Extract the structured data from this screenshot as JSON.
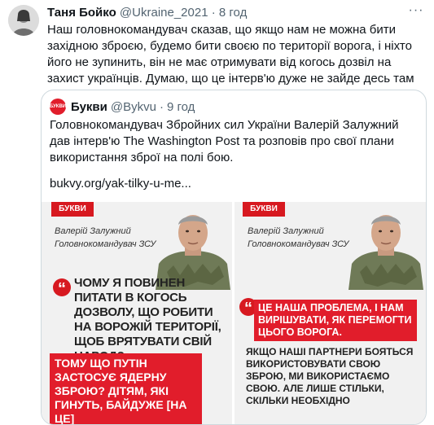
{
  "author": {
    "name": "Таня Бойко",
    "handle": "@Ukraine_2021",
    "separator": "·",
    "time": "8 год"
  },
  "more_label": "···",
  "tweet_text": "Наш головнокомандувач сказав, що якщо нам не можна бити західною зброєю, будемо бити своєю по території ворога, і ніхто його не зупинить, він не має отримувати від когось дозвіл на захист українців. Думаю, що це інтерв'ю дуже не зайде десь там кой кому.",
  "quoted": {
    "logo_text": "БУКВИ",
    "name": "Букви",
    "handle": "@Bykvu",
    "separator": "·",
    "time": "9 год",
    "text": "Головнокомандувач Збройних сил України Валерій Залужний дав інтерв'ю The Washington Post та розповів про свої плани використання зброї на полі бою.",
    "link": "bukvy.org/yak-tilky-u-me..."
  },
  "images": {
    "left": {
      "brand": "БУКВИ",
      "person_name": "Валерій Залужний",
      "person_title": "Головнокомандувач ЗСУ",
      "quote_mark": "“",
      "question": "ЧОМУ Я ПОВИНЕН ПИТАТИ В КОГОСЬ ДОЗВОЛУ, ЩО РОБИТИ НА ВОРОЖІЙ ТЕРИТОРІЇ, ЩОБ ВРЯТУВАТИ СВІЙ НАРОД?",
      "answer": "ТОМУ ЩО ПУТІН ЗАСТОСУЄ ЯДЕРНУ ЗБРОЮ? ДІТЯМ, ЯКІ ГИНУТЬ, БАЙДУЖЕ [НА ЦЕ]"
    },
    "right": {
      "brand": "БУКВИ",
      "person_name": "Валерій Залужний",
      "person_title": "Головнокомандувач ЗСУ",
      "quote_mark": "“",
      "highlight": "ЦЕ НАША ПРОБЛЕМА, І НАМ ВИРІШУВАТИ, ЯК ПЕРЕМОГТИ ЦЬОГО ВОРОГА.",
      "text": "ЯКЩО НАШІ ПАРТНЕРИ БОЯТЬСЯ ВИКОРИСТОВУВАТИ СВОЮ ЗБРОЮ, МИ ВИКОРИСТАЄМО СВОЮ. АЛЕ ЛИШЕ СТІЛЬКИ, СКІЛЬКИ НЕОБХІДНО"
    }
  },
  "colors": {
    "accent_red": "#e11d2b",
    "text_primary": "#0f1419",
    "text_secondary": "#536471",
    "border": "#cfd9de"
  }
}
